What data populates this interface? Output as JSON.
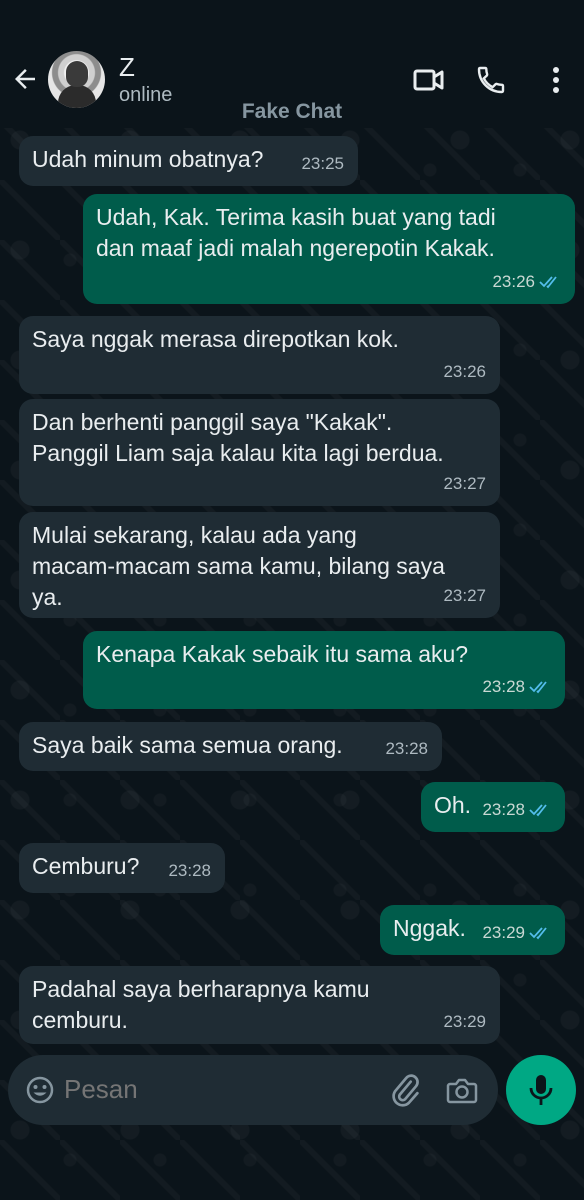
{
  "header": {
    "contact_name": "Z",
    "contact_status": "online",
    "overlay_label": "Fake Chat"
  },
  "messages": [
    {
      "direction": "in",
      "text": "Udah minum obatnya?",
      "time": "23:25",
      "read": false
    },
    {
      "direction": "out",
      "text": "Udah, Kak. Terima kasih buat yang tadi\ndan maaf jadi malah ngerepotin Kakak.",
      "time": "23:26",
      "read": true
    },
    {
      "direction": "in",
      "text": "Saya nggak merasa direpotkan kok.",
      "time": "23:26",
      "read": false
    },
    {
      "direction": "in",
      "text": "Dan berhenti panggil saya \"Kakak\".\nPanggil Liam saja kalau kita lagi berdua.",
      "time": "23:27",
      "read": false
    },
    {
      "direction": "in",
      "text": "Mulai sekarang, kalau ada yang\nmacam-macam sama kamu, bilang saya\nya.",
      "time": "23:27",
      "read": false
    },
    {
      "direction": "out",
      "text": "Kenapa Kakak sebaik itu sama aku?",
      "time": "23:28",
      "read": true
    },
    {
      "direction": "in",
      "text": "Saya baik sama semua orang.",
      "time": "23:28",
      "read": false
    },
    {
      "direction": "out",
      "text": "Oh.",
      "time": "23:28",
      "read": true
    },
    {
      "direction": "in",
      "text": "Cemburu?",
      "time": "23:28",
      "read": false
    },
    {
      "direction": "out",
      "text": "Nggak.",
      "time": "23:29",
      "read": true
    },
    {
      "direction": "in",
      "text": "Padahal saya berharapnya kamu\ncemburu.",
      "time": "23:29",
      "read": false
    }
  ],
  "composer": {
    "placeholder": "Pesan"
  },
  "colors": {
    "background": "#0b141a",
    "incoming_bubble": "#1f2c34",
    "outgoing_bubble": "#005c4b",
    "accent": "#00a884",
    "read_tick": "#53bdeb"
  },
  "icons": {
    "back": "arrow-left-icon",
    "video": "video-call-icon",
    "call": "phone-icon",
    "more": "more-vert-icon",
    "emoji": "emoji-icon",
    "attach": "paperclip-icon",
    "camera": "camera-icon",
    "mic": "mic-icon",
    "tick": "double-check-icon"
  }
}
